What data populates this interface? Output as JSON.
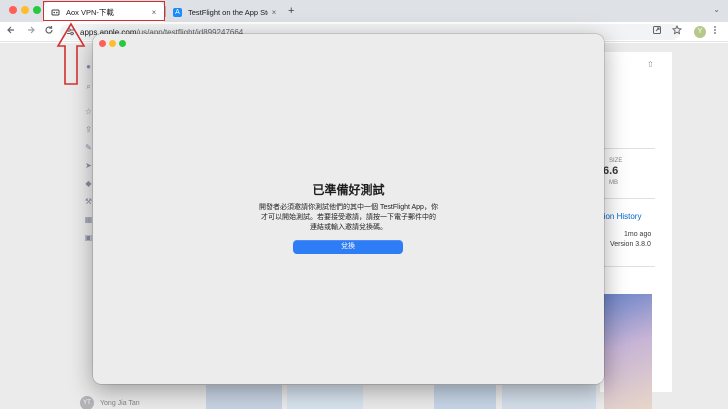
{
  "browser": {
    "tabs": [
      {
        "title": "Aox VPN-下載",
        "close": "×"
      },
      {
        "title": "TestFlight on the App Store",
        "close": "×"
      }
    ],
    "new_tab": "+",
    "tab_menu": "⌄",
    "url_host": "apps.apple.com",
    "url_path": "/us/app/testflight/id899247664",
    "profile_initial": "Y"
  },
  "store_page": {
    "size_label": "SIZE",
    "size_value": "6.6",
    "size_unit": "MB",
    "version_history_link": "rsion History",
    "version_time": "1mo ago",
    "version_number": "Version 3.8.0",
    "review_user_initials": "YT",
    "review_user_name": "Yong Jia Tan"
  },
  "modal": {
    "title": "已準備好測試",
    "body_lines": [
      "開發者必須邀請你測試他們的其中一個 TestFlight App，你",
      "才可以開始測試。若要接受邀請，請按一下電子郵件中的",
      "連結或輸入邀請兌換碼。"
    ],
    "redeem_button": "兌換"
  },
  "colors": {
    "accent_button": "#2e7cf6",
    "annotation_red": "#d32f2f",
    "link_blue": "#0066cc"
  }
}
